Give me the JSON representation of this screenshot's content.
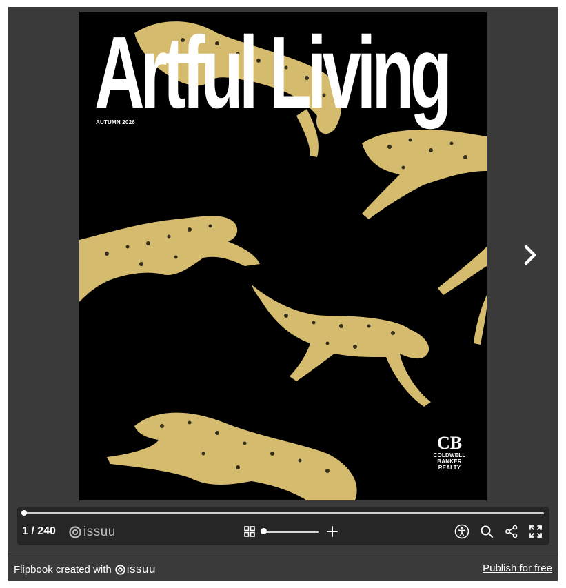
{
  "cover": {
    "title": "Artful Living",
    "issue_label": "AUTUMN 2026",
    "background_color": "#000000",
    "cheetah_color": "#d4bb6e",
    "brand_logo": {
      "mark": "CB",
      "line1": "COLDWELL",
      "line2": "BANKER",
      "line3": "REALTY"
    }
  },
  "navigation": {
    "next_icon": "chevron-right-icon"
  },
  "toolbar": {
    "progress_fraction": 0.004,
    "page_counter": "1 / 240",
    "issuu_label": "issuu",
    "icons": [
      "grid-icon",
      "zoom-in-icon",
      "accessibility-icon",
      "search-icon",
      "share-icon",
      "fullscreen-icon"
    ]
  },
  "footer": {
    "credit_text": "Flipbook created with",
    "credit_brand": "issuu",
    "publish_link": "Publish for free"
  }
}
